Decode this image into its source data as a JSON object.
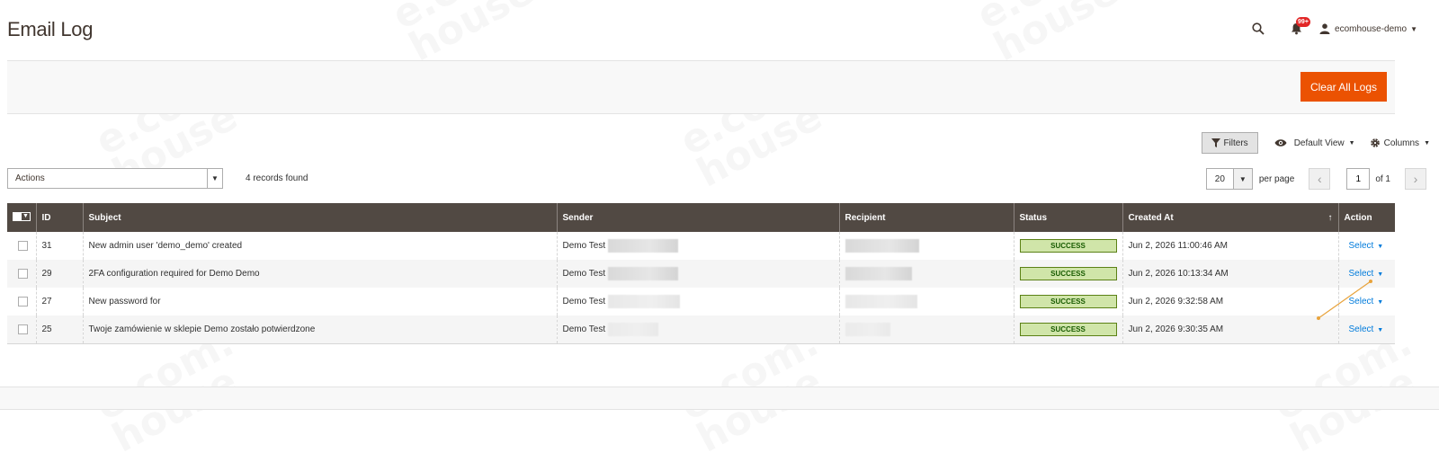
{
  "page": {
    "title": "Email Log"
  },
  "header": {
    "account_name": "ecomhouse-demo",
    "notifications_count": "99+"
  },
  "watermark": {
    "text": "e.com.\nhouse"
  },
  "action_bar": {
    "clear_button": "Clear All Logs"
  },
  "toolbar": {
    "filters_label": "Filters",
    "view_label": "Default View",
    "columns_label": "Columns"
  },
  "mass_actions": {
    "selected": "Actions"
  },
  "records_found": "4 records found",
  "pager": {
    "per_page_value": "20",
    "per_page_label": "per page",
    "current_page": "1",
    "of_label": "of 1"
  },
  "table": {
    "columns": [
      "ID",
      "Subject",
      "Sender",
      "Recipient",
      "Status",
      "Created At",
      "Action"
    ],
    "rows": [
      {
        "id": "31",
        "subject": "New admin user 'demo_demo' created",
        "sender": "Demo Test",
        "status": "SUCCESS",
        "created_at": "Jun 2, 2026 11:00:46 AM",
        "action": "Select"
      },
      {
        "id": "29",
        "subject": "2FA configuration required for Demo Demo",
        "sender": "Demo Test",
        "status": "SUCCESS",
        "created_at": "Jun 2, 2026 10:13:34 AM",
        "action": "Select"
      },
      {
        "id": "27",
        "subject": "New password for",
        "sender": "Demo Test",
        "status": "SUCCESS",
        "created_at": "Jun 2, 2026 9:32:58 AM",
        "action": "Select"
      },
      {
        "id": "25",
        "subject": "Twoje zamówienie w sklepie Demo zostało potwierdzone",
        "sender": "Demo Test",
        "status": "SUCCESS",
        "created_at": "Jun 2, 2026 9:30:35 AM",
        "action": "Select"
      }
    ]
  },
  "icons": [
    "search-icon",
    "bell-icon",
    "user-icon",
    "filter-icon",
    "eye-icon",
    "gear-icon",
    "chevron-left-icon",
    "chevron-right-icon",
    "sort-asc-icon"
  ],
  "colors": {
    "accent": "#eb5202",
    "header_bg": "#514943",
    "link": "#007bdb",
    "success_bg": "#d0e5a9",
    "success_border": "#5b8116"
  }
}
